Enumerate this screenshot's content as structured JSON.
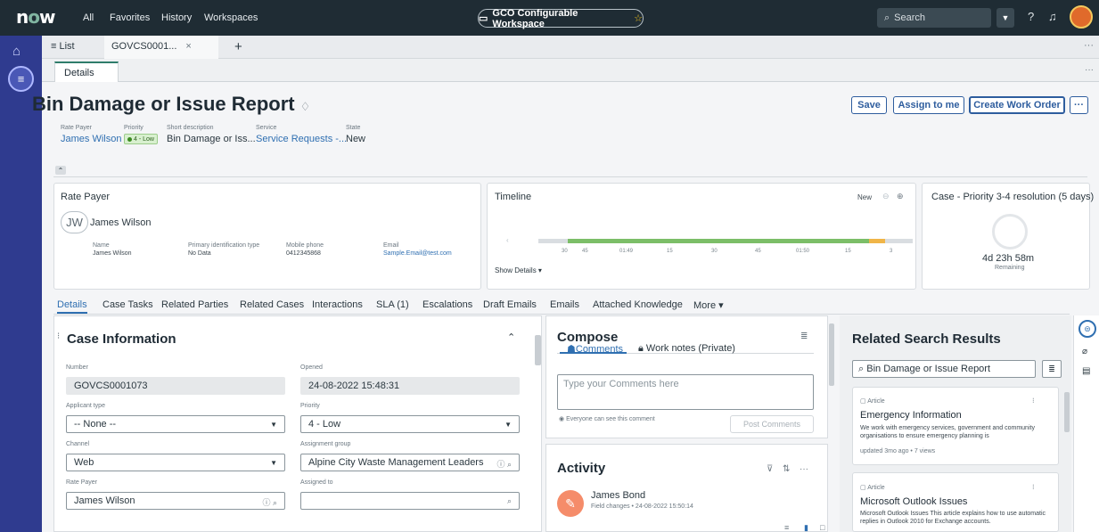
{
  "topbar": {
    "logo": "now",
    "nav": [
      "All",
      "Favorites",
      "History",
      "Workspaces"
    ],
    "workspace": "GCO Configurable Workspace",
    "search_placeholder": "Search"
  },
  "tabs": {
    "list_label": "≡ List",
    "record_tab": "GOVCS0001...",
    "details_tab": "Details"
  },
  "record": {
    "title": "Bin Damage or Issue Report",
    "highlights": [
      {
        "label": "Rate Payer",
        "value": "James Wilson"
      },
      {
        "label": "Priority",
        "value": "4 - Low"
      },
      {
        "label": "Short description",
        "value": "Bin Damage or Iss..."
      },
      {
        "label": "Service",
        "value": "Service Requests -..."
      },
      {
        "label": "State",
        "value": "New"
      }
    ],
    "buttons": {
      "save": "Save",
      "assign": "Assign to me",
      "create": "Create Work Order",
      "more": "···"
    }
  },
  "ratepayer_card": {
    "title": "Rate Payer",
    "initials": "JW",
    "name": "James Wilson",
    "fields": [
      {
        "label": "Name",
        "value": "James Wilson"
      },
      {
        "label": "Primary identification type",
        "value": "No Data"
      },
      {
        "label": "Mobile phone",
        "value": "0412345868"
      },
      {
        "label": "Email",
        "value": "Sample.Email@test.com"
      }
    ]
  },
  "timeline_card": {
    "title": "Timeline",
    "status": "New",
    "ticks": [
      "30",
      "45",
      "01:49",
      "15",
      "30",
      "45",
      "01:50",
      "15",
      "3"
    ],
    "show_details": "Show Details ▾"
  },
  "sla_card": {
    "title": "Case - Priority 3-4 resolution (5 days)",
    "remaining_time": "4d 23h 58m",
    "remaining_label": "Remaining"
  },
  "record_tabs": [
    "Details",
    "Case Tasks",
    "Related Parties",
    "Related Cases",
    "Interactions",
    "SLA (1)",
    "Escalations",
    "Draft Emails",
    "Emails",
    "Attached Knowledge",
    "More ▾"
  ],
  "case_info": {
    "title": "Case Information",
    "fields": {
      "number": {
        "label": "Number",
        "value": "GOVCS0001073"
      },
      "opened": {
        "label": "Opened",
        "value": "24-08-2022 15:48:31"
      },
      "applicant_type": {
        "label": "Applicant type",
        "value": "-- None --"
      },
      "priority": {
        "label": "Priority",
        "value": "4 - Low"
      },
      "channel": {
        "label": "Channel",
        "value": "Web"
      },
      "assignment_group": {
        "label": "Assignment group",
        "value": "Alpine City Waste Management Leaders"
      },
      "rate_payer": {
        "label": "Rate Payer",
        "value": "James Wilson"
      },
      "assigned_to": {
        "label": "Assigned to",
        "value": ""
      }
    }
  },
  "compose": {
    "title": "Compose",
    "tab_comments": "Comments",
    "tab_worknotes": "Work notes (Private)",
    "placeholder": "Type your Comments here",
    "visibility_note": "Everyone can see this comment",
    "post_button": "Post Comments"
  },
  "activity": {
    "title": "Activity",
    "entries": [
      {
        "author": "James Bond",
        "detail": "Field changes • 24-08-2022 15:50:14"
      }
    ]
  },
  "related": {
    "title": "Related Search Results",
    "search_value": "Bin Damage or Issue Report",
    "articles": [
      {
        "type": "Article",
        "title": "Emergency Information",
        "body": "We work with emergency services, government and community organisations to ensure emergency planning is",
        "meta": "updated 3mo ago • 7 views"
      },
      {
        "type": "Article",
        "title": "Microsoft Outlook Issues",
        "body": "Microsoft Outlook Issues This article explains how to use automatic replies in Outlook 2010 for Exchange accounts.",
        "meta": ""
      }
    ]
  }
}
